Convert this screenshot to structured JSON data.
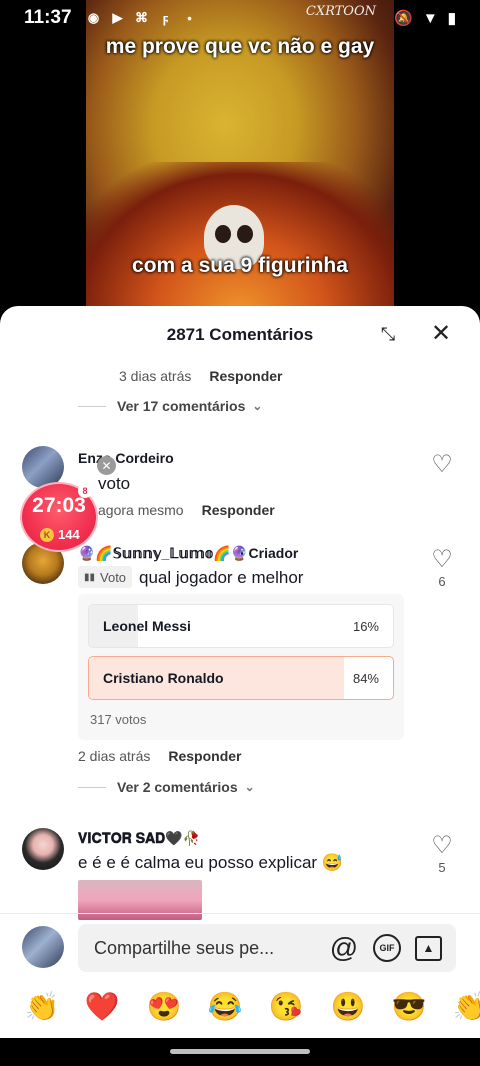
{
  "status_bar": {
    "time": "11:37",
    "icons": [
      "camera-icon",
      "play-icon",
      "app-icon",
      "flash-icon",
      "dot-icon"
    ],
    "right_icons": [
      "mute-icon",
      "wifi-icon",
      "battery-icon"
    ]
  },
  "video": {
    "caption_top": "me prove que vc não e gay",
    "caption_bottom": "com a sua 9 figurinha",
    "watermark": "CXRTOON"
  },
  "sheet": {
    "title": "2871 Comentários",
    "expand_icon": "⤡",
    "close_icon": "✕"
  },
  "thread_top": {
    "time": "3 dias atrás",
    "reply": "Responder",
    "view_more": "Ver 17 comentários"
  },
  "comments": [
    {
      "username": "Enzo Cordeiro",
      "text": "voto",
      "time": "agora mesmo",
      "reply": "Responder",
      "likes": ""
    },
    {
      "username": "🔮🌈𝕊𝕦𝕟𝕟𝕪_𝕃𝕦𝕞𝕠🌈🔮",
      "creator_label": "· Criador",
      "vote_tag": "Voto",
      "text": "qual jogador e melhor",
      "likes": "6",
      "time": "2 dias atrás",
      "reply": "Responder",
      "view_more": "Ver 2 comentários"
    },
    {
      "username": "𝐕𝐈𝐂𝐓𝐎𝐑 𝐒𝐀𝐃🖤🥀",
      "text": "e é e é calma eu posso explicar 😅",
      "likes": "5"
    }
  ],
  "poll": {
    "options": [
      {
        "label": "Leonel Messi",
        "percent": "16%",
        "share": 0.16,
        "selected": false
      },
      {
        "label": "Cristiano Ronaldo",
        "percent": "84%",
        "share": 0.84,
        "selected": true
      }
    ],
    "total": "317 votos"
  },
  "timer": {
    "value": "27:03",
    "coins": "144",
    "badge": "8",
    "coin_symbol": "K",
    "close": "✕"
  },
  "composer": {
    "placeholder": "Compartilhe seus pe...",
    "at_icon": "@",
    "gif_label": "GIF",
    "image_icon": "🖼"
  },
  "emojis": [
    "👏",
    "❤️",
    "😍",
    "😂",
    "😘",
    "😃",
    "😎",
    "👏"
  ],
  "colors": {
    "poll_selected_fill": "#fde6dd",
    "poll_selected_border": "#f8a98e",
    "timer_red": "#ef2a4a"
  }
}
